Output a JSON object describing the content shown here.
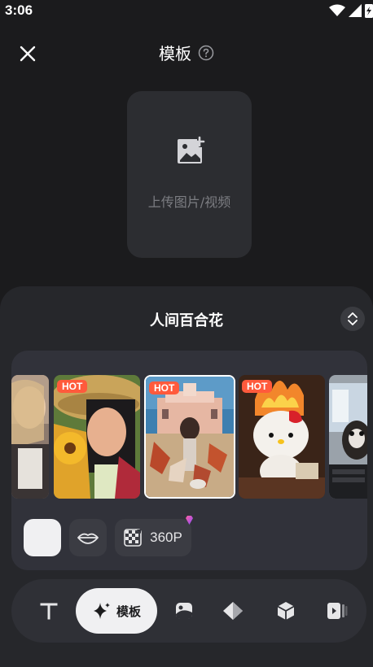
{
  "status_bar": {
    "time": "3:06"
  },
  "header": {
    "title": "模板"
  },
  "upload": {
    "label": "上传图片/视频"
  },
  "sheet": {
    "title": "人间百合花",
    "hot_label": "HOT",
    "templates": [
      {
        "hot": false,
        "selected": false
      },
      {
        "hot": true,
        "selected": false
      },
      {
        "hot": true,
        "selected": true
      },
      {
        "hot": true,
        "selected": false
      },
      {
        "hot": false,
        "selected": false
      }
    ],
    "quality_label": "360P"
  },
  "toolbar": {
    "items": [
      {
        "icon": "text-icon"
      },
      {
        "icon": "sparkle-icon",
        "label": "模板"
      },
      {
        "icon": "sticker-icon"
      },
      {
        "icon": "filter-icon"
      },
      {
        "icon": "cube-icon"
      },
      {
        "icon": "video-icon"
      }
    ]
  },
  "colors": {
    "background": "#1b1b1d",
    "sheet": "#26272b",
    "panel": "#31323a",
    "hot": "#ff5a3c",
    "active": "#f0f0f2"
  }
}
